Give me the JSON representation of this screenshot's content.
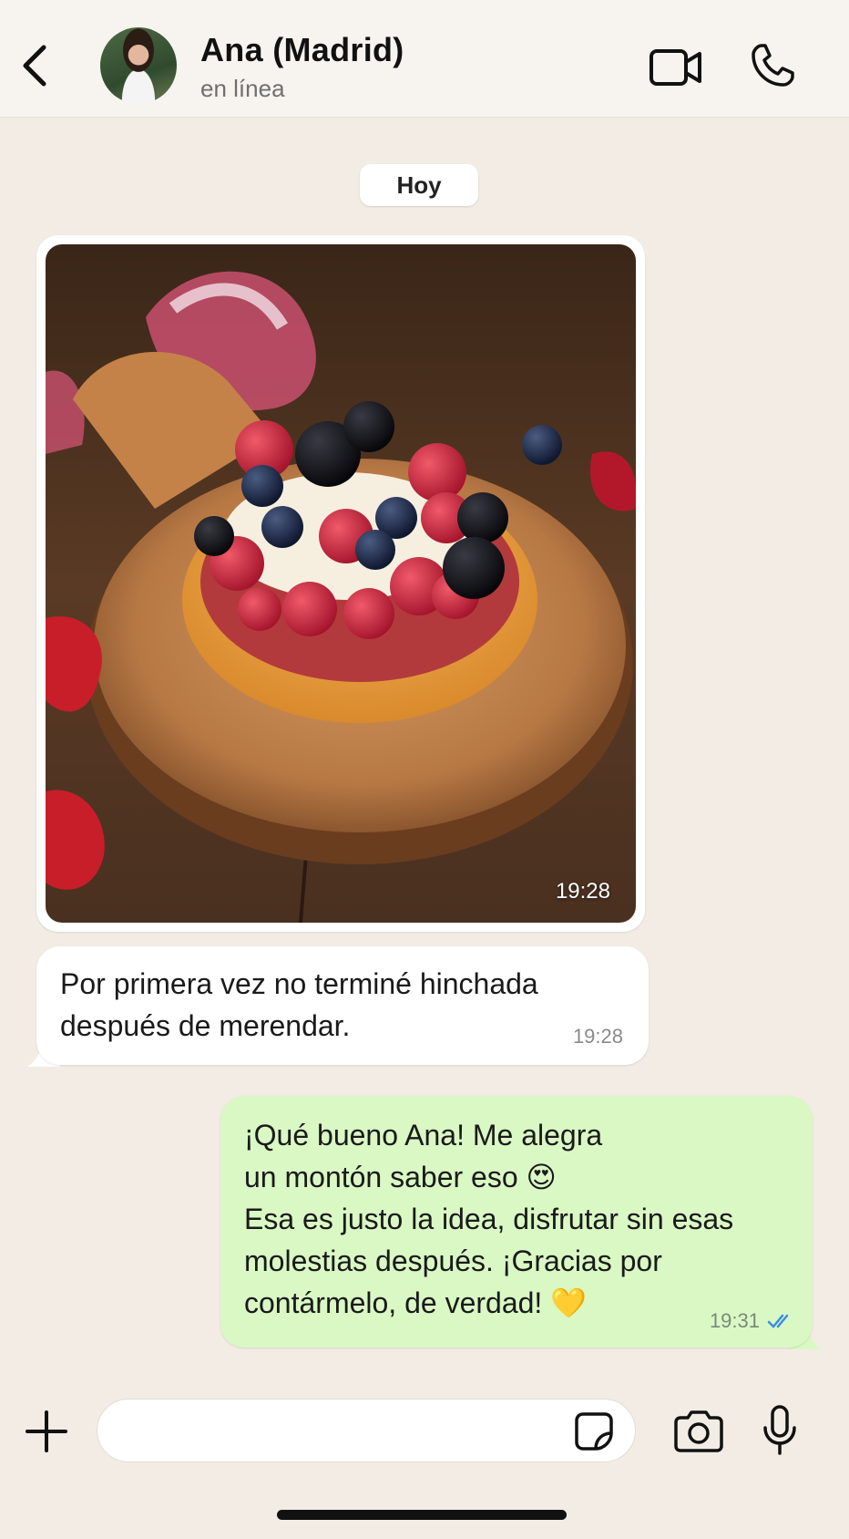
{
  "header": {
    "contact_name": "Ana (Madrid)",
    "status": "en línea"
  },
  "chat": {
    "date_label": "Hoy",
    "messages": [
      {
        "type": "image",
        "direction": "incoming",
        "time": "19:28"
      },
      {
        "type": "text",
        "direction": "incoming",
        "text": "Por primera vez no terminé hinchada después de merendar.",
        "time": "19:28"
      },
      {
        "type": "text",
        "direction": "outgoing",
        "text": "¡Qué bueno Ana! Me alegra\nun montón saber eso 😍\nEsa es justo la idea, disfrutar sin esas molestias después. ¡Gracias por contármelo, de verdad! 💛",
        "time": "19:31",
        "read": true
      }
    ]
  },
  "composer": {
    "value": "",
    "placeholder": ""
  },
  "colors": {
    "background": "#f3ece4",
    "outgoing_bubble": "#d9f8c4",
    "incoming_bubble": "#ffffff",
    "read_ticks": "#3b8be8"
  },
  "icons": [
    "back-arrow-icon",
    "video-camera-icon",
    "phone-icon",
    "plus-icon",
    "sticker-icon",
    "camera-icon",
    "microphone-icon",
    "double-check-icon"
  ]
}
